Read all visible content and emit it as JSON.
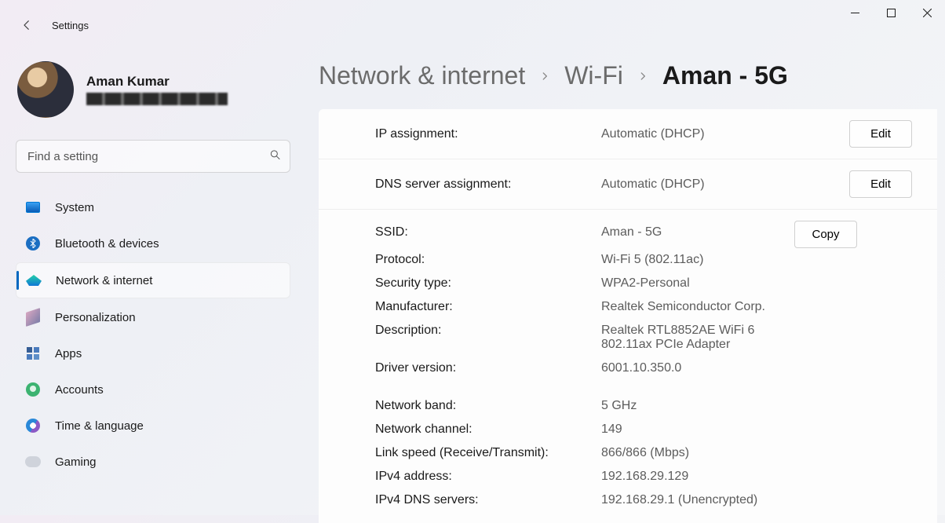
{
  "app_title": "Settings",
  "profile": {
    "name": "Aman Kumar"
  },
  "search": {
    "placeholder": "Find a setting"
  },
  "nav": {
    "system": "System",
    "bluetooth": "Bluetooth & devices",
    "network": "Network & internet",
    "personalization": "Personalization",
    "apps": "Apps",
    "accounts": "Accounts",
    "time": "Time & language",
    "gaming": "Gaming"
  },
  "breadcrumb": {
    "a": "Network & internet",
    "b": "Wi-Fi",
    "c": "Aman - 5G"
  },
  "rows": {
    "ip_assign": {
      "label": "IP assignment:",
      "value": "Automatic (DHCP)",
      "action": "Edit"
    },
    "dns_assign": {
      "label": "DNS server assignment:",
      "value": "Automatic (DHCP)",
      "action": "Edit"
    }
  },
  "details": {
    "copy_label": "Copy",
    "ssid": {
      "label": "SSID:",
      "value": "Aman - 5G"
    },
    "protocol": {
      "label": "Protocol:",
      "value": "Wi-Fi 5 (802.11ac)"
    },
    "security": {
      "label": "Security type:",
      "value": "WPA2-Personal"
    },
    "manufacturer": {
      "label": "Manufacturer:",
      "value": "Realtek Semiconductor Corp."
    },
    "description": {
      "label": "Description:",
      "value": "Realtek RTL8852AE WiFi 6 802.11ax PCIe Adapter"
    },
    "driver": {
      "label": "Driver version:",
      "value": "6001.10.350.0"
    },
    "band": {
      "label": "Network band:",
      "value": "5 GHz"
    },
    "channel": {
      "label": "Network channel:",
      "value": "149"
    },
    "link": {
      "label": "Link speed (Receive/Transmit):",
      "value": "866/866 (Mbps)"
    },
    "ipv4": {
      "label": "IPv4 address:",
      "value": "192.168.29.129"
    },
    "ipv4dns": {
      "label": "IPv4 DNS servers:",
      "value": "192.168.29.1 (Unencrypted)"
    }
  }
}
